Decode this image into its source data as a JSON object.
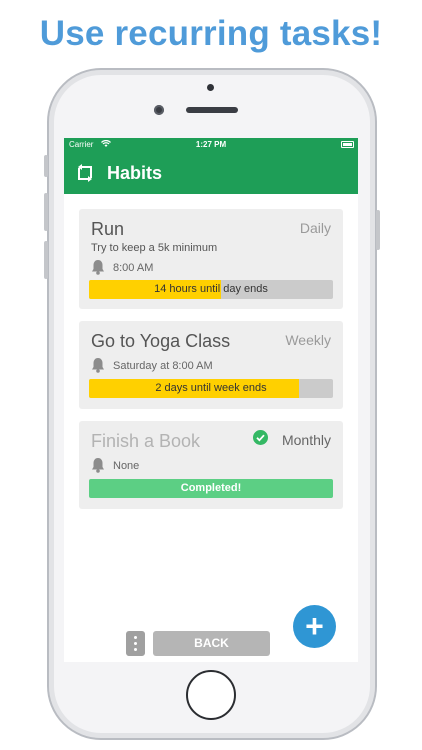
{
  "headline": "Use recurring tasks!",
  "status_bar": {
    "carrier": "Carrier",
    "time": "1:27 PM"
  },
  "nav": {
    "title": "Habits"
  },
  "habits": [
    {
      "name": "Run",
      "frequency": "Daily",
      "description": "Try to keep a 5k minimum",
      "reminder": "8:00 AM",
      "progress_text": "14 hours until day ends",
      "progress_fraction": 0.54,
      "completed": false
    },
    {
      "name": "Go to Yoga Class",
      "frequency": "Weekly",
      "description": "",
      "reminder": "Saturday at 8:00 AM",
      "progress_text": "2 days until week ends",
      "progress_fraction": 0.86,
      "completed": false
    },
    {
      "name": "Finish a Book",
      "frequency": "Monthly",
      "description": "",
      "reminder": "None",
      "progress_text": "Completed!",
      "progress_fraction": 1.0,
      "completed": true
    }
  ],
  "actions": {
    "back_label": "BACK",
    "add_label": "+"
  },
  "colors": {
    "brand_green": "#1e9e57",
    "progress_yellow": "#ffd000",
    "completed_green": "#5ccf84",
    "fab_blue": "#2f96d4",
    "headline_blue": "#4f9bd9"
  }
}
